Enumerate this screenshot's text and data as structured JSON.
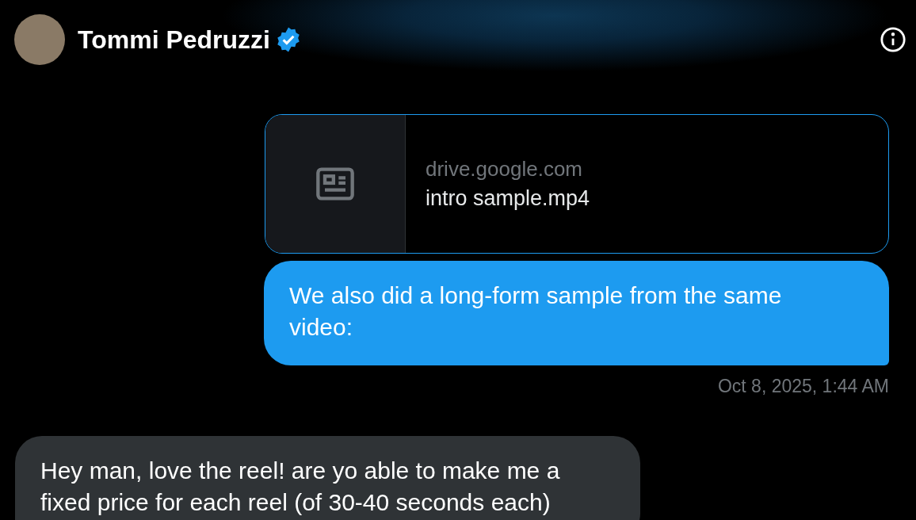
{
  "header": {
    "name": "Tommi Pedruzzi",
    "verified": true
  },
  "messages": [
    {
      "kind": "link_card",
      "outgoing": true,
      "domain": "drive.google.com",
      "title": "intro sample.mp4"
    },
    {
      "kind": "text",
      "outgoing": true,
      "text": "We also did a long-form sample from the same video:"
    },
    {
      "kind": "timestamp",
      "outgoing": true,
      "text": "Oct 8, 2025, 1:44 AM"
    },
    {
      "kind": "text",
      "outgoing": false,
      "text": "Hey man, love the reel! are yo able to make me a fixed price for each reel (of 30-40 seconds each)"
    }
  ]
}
